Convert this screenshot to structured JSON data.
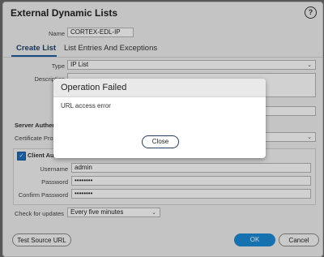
{
  "dialog": {
    "title": "External Dynamic Lists",
    "help_label": "?"
  },
  "form": {
    "name_label": "Name",
    "name_value": "CORTEX-EDL-IP",
    "tabs": [
      {
        "label": "Create List",
        "active": true
      },
      {
        "label": "List Entries And Exceptions",
        "active": false
      }
    ],
    "type_label": "Type",
    "type_value": "IP List",
    "description_label": "Description",
    "source_label_partial": "Sou",
    "server_auth_label_partial": "Server Authen",
    "certificate_label_partial": "Certificate Pro",
    "client_auth_label_partial": "Client Auth",
    "client_auth_checked": true,
    "username_label": "Username",
    "username_value": "admin",
    "password_label": "Password",
    "password_value": "••••••••",
    "confirm_password_label": "Confirm Password",
    "confirm_password_value": "••••••••",
    "check_updates_label": "Check for updates",
    "check_updates_value": "Every five minutes"
  },
  "footer": {
    "test_button": "Test Source URL",
    "ok_button": "OK",
    "cancel_button": "Cancel"
  },
  "error_modal": {
    "title": "Operation Failed",
    "message": "URL access error",
    "close_button": "Close"
  },
  "colors": {
    "primary_button": "#1a8ad6",
    "modal_border": "#2a3e60",
    "tab_active": "#1f3f6f"
  }
}
